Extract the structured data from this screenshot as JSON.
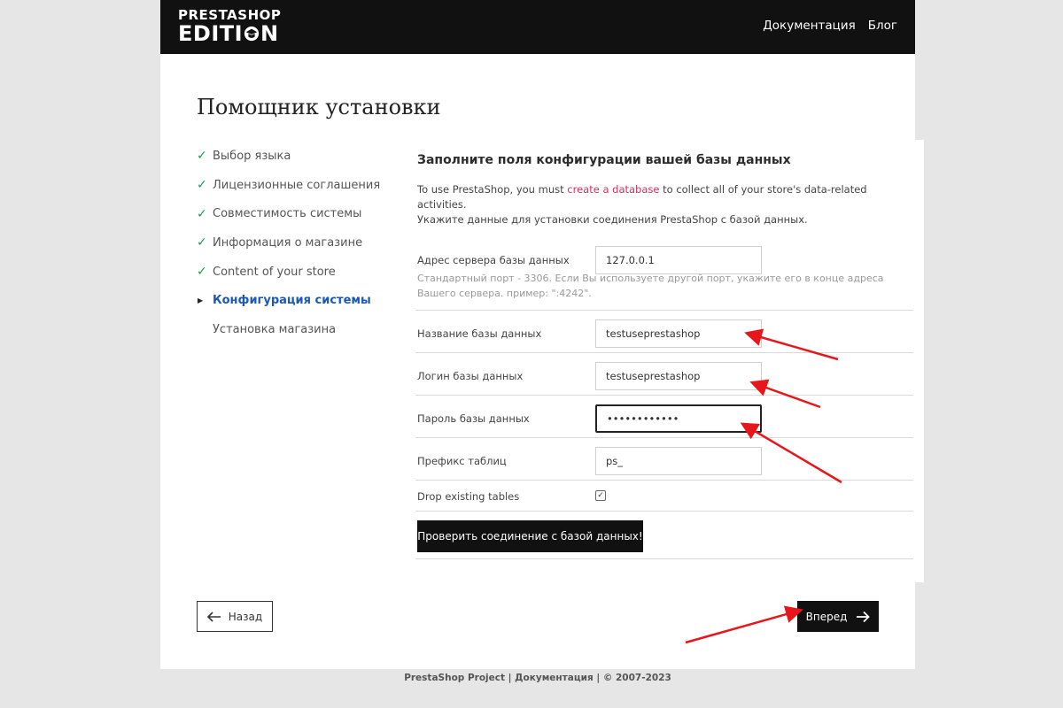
{
  "header": {
    "logo_line1": "PRESTASHOP",
    "logo_line2a": "EDITI",
    "logo_line2b": "N",
    "nav": {
      "docs": "Документация",
      "blog": "Блог"
    }
  },
  "page_title": "Помощник установки",
  "steps": [
    {
      "label": "Выбор языка",
      "state": "done"
    },
    {
      "label": "Лицензионные соглашения",
      "state": "done"
    },
    {
      "label": "Совместимость системы",
      "state": "done"
    },
    {
      "label": "Информация о магазине",
      "state": "done"
    },
    {
      "label": "Content of your store",
      "state": "done"
    },
    {
      "label": "Конфигурация системы",
      "state": "active"
    },
    {
      "label": "Установка магазина",
      "state": "pending"
    }
  ],
  "form": {
    "heading": "Заполните поля конфигурации вашей базы данных",
    "intro_pre": "To use PrestaShop, you must ",
    "intro_link": "create a database",
    "intro_post": " to collect all of your store's data-related activities.",
    "intro_line2": "Укажите данные для установки соединения PrestaShop с базой данных.",
    "server_label": "Адрес сервера базы данных",
    "server_value": "127.0.0.1",
    "server_hint": "Стандартный порт - 3306. Если Вы используете другой порт, укажите его в конце адреса Вашего сервера. пример: \":4242\".",
    "dbname_label": "Название базы данных",
    "dbname_value": "testuseprestashop",
    "login_label": "Логин базы данных",
    "login_value": "testuseprestashop",
    "password_label": "Пароль базы данных",
    "password_value": "••••••••••••",
    "prefix_label": "Префикс таблиц",
    "prefix_value": "ps_",
    "drop_label": "Drop existing tables",
    "drop_checked": true,
    "check_mark": "✓",
    "check_button": "Проверить соединение с базой данных!"
  },
  "nav_buttons": {
    "back": "Назад",
    "next": "Вперед"
  },
  "footer": "PrestaShop Project | Документация | © 2007-2023",
  "colors": {
    "accent_link": "#d1335b",
    "active_step": "#1c59b4",
    "check_green": "#1a9c4a",
    "annotation_arrow": "#e8161b"
  }
}
